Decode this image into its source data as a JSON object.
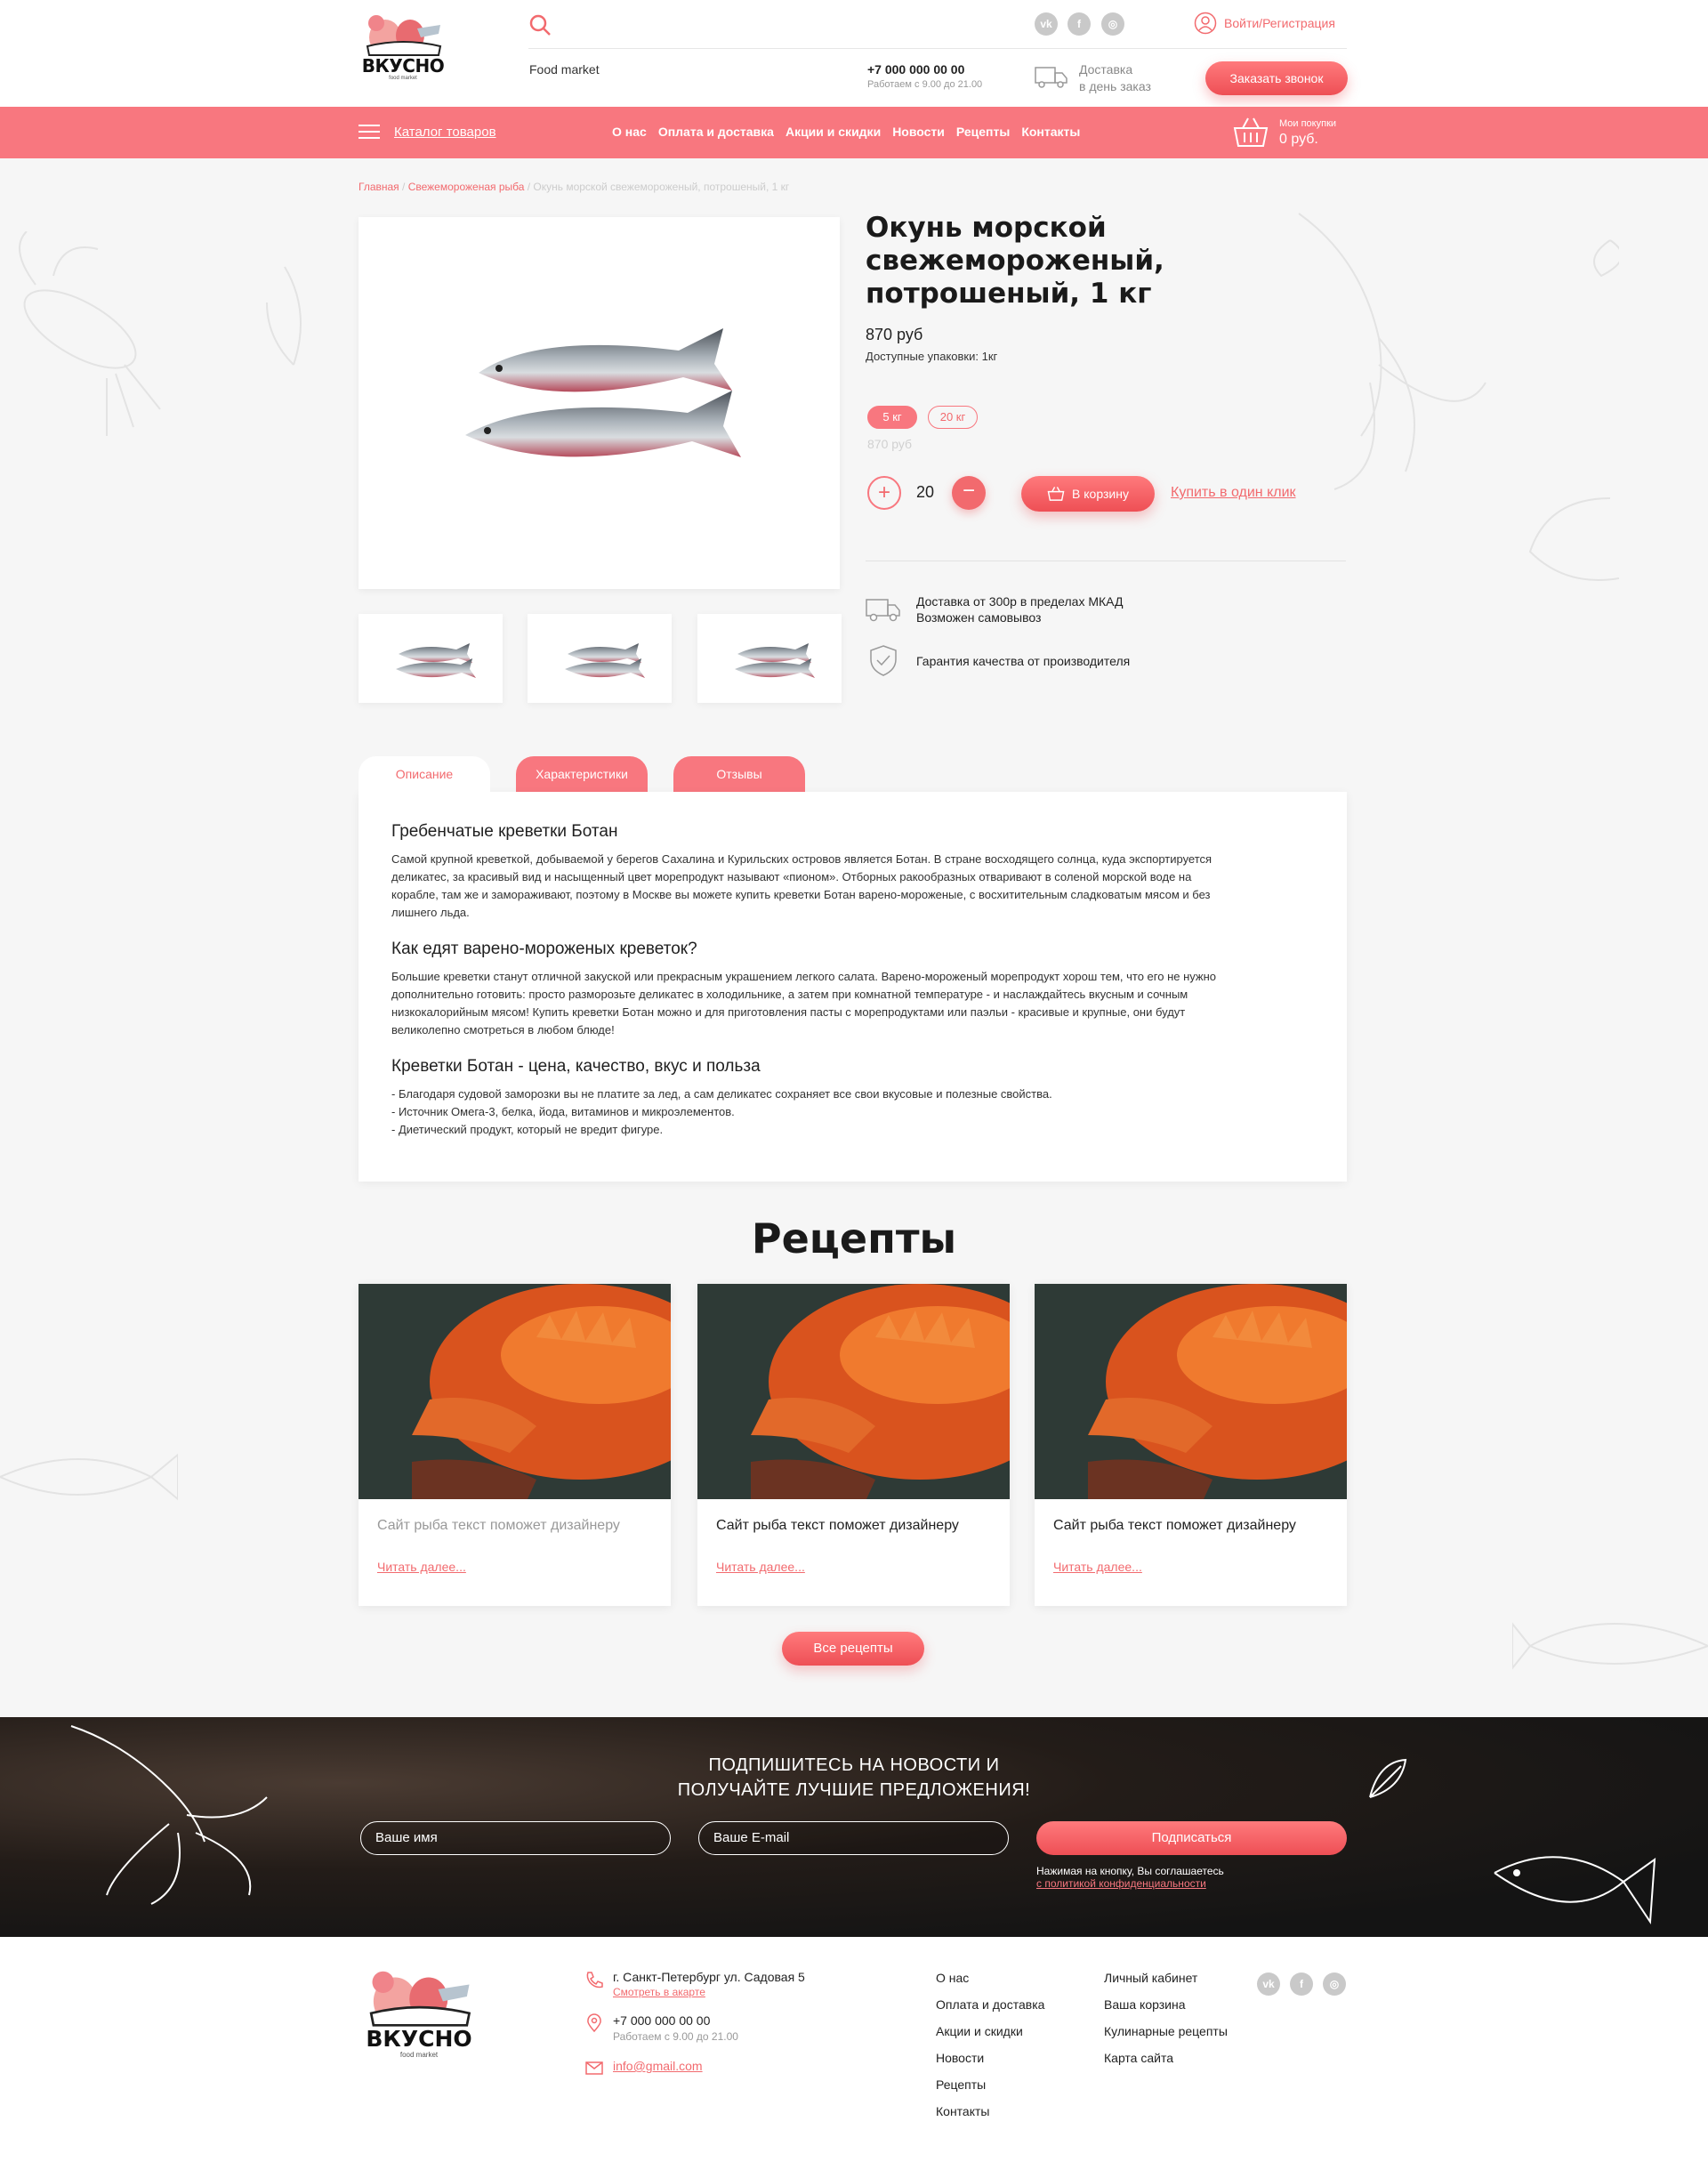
{
  "header": {
    "brand": "ВКУСНО",
    "brand_sub": "food market",
    "tagline": "Food market",
    "phone": "+7 000 000 00 00",
    "hours": "Работаем с 9.00 до 21.00",
    "delivery_line1": "Доставка",
    "delivery_line2": "в день заказ",
    "login": "Войти/Регистрация",
    "callback": "Заказать звонок",
    "social": [
      "vk-icon",
      "facebook-icon",
      "instagram-icon"
    ]
  },
  "nav": {
    "catalog": "Каталог товаров",
    "items": [
      "О нас",
      "Оплата и доставка",
      "Акции и скидки",
      "Новости",
      "Рецепты",
      "Контакты"
    ],
    "cart_label": "Мои покупки",
    "cart_value": "0 руб."
  },
  "breadcrumb": {
    "home": "Главная",
    "category": "Свежемороженая рыба",
    "current": "Окунь морской свежемороженый, потрошеный, 1 кг"
  },
  "product": {
    "title": "Окунь морской свежемороженый, потрошеный, 1 кг",
    "price": "870 руб",
    "available": "Доступные упаковки: 1кг",
    "packs": [
      "5 кг",
      "20 кг"
    ],
    "old_price": "870 руб",
    "qty_minus": "+",
    "qty_plus": "−",
    "quantity": "20",
    "to_cart": "В корзину",
    "one_click": "Купить в один клик",
    "feature_delivery_1": "Доставка от 300р в пределах МКАД",
    "feature_delivery_2": "Возможен самовывоз",
    "feature_quality": "Гарантия качества от производителя"
  },
  "tabs": [
    "Описание",
    "Характеристики",
    "Отзывы"
  ],
  "description": {
    "h1": "Гребенчатые креветки Ботан",
    "p1": "Самой крупной креветкой, добываемой у берегов Сахалина и Курильских островов является Ботан. В стране восходящего солнца, куда экспортируется деликатес, за красивый вид и насыщенный цвет морепродукт называют «пионом». Отборных ракообразных отваривают в соленой морской воде на корабле, там же и замораживают, поэтому в Москве вы можете купить креветки Ботан варено-мороженые, с восхитительным сладковатым мясом и без лишнего льда.",
    "h2": "Как едят варено-мороженых креветок?",
    "p2": "Большие креветки станут отличной закуской или прекрасным украшением легкого салата. Варено-мороженый морепродукт хорош тем, что его не нужно дополнительно готовить: просто разморозьте деликатес в холодильнике, а затем при комнатной температуре - и наслаждайтесь вкусным и сочным низкокалорийным мясом! Купить креветки Ботан можно и для приготовления пасты с морепродуктами или паэльи - красивые и крупные, они будут великолепно смотреться в любом блюде!",
    "h3": "Креветки Ботан - цена, качество, вкус и польза",
    "li1": "- Благодаря судовой заморозки вы не платите за лед, а сам деликатес сохраняет все свои вкусовые и полезные свойства.",
    "li2": "- Источник Омега-3, белка, йода, витаминов и микроэлементов.",
    "li3": "- Диетический продукт, который не вредит фигуре."
  },
  "recipes": {
    "title": "Рецепты",
    "cards": [
      {
        "text": "Сайт рыба текст поможет дизайнеру",
        "more": "Читать далее..."
      },
      {
        "text": "Сайт рыба текст поможет дизайнеру",
        "more": "Читать далее..."
      },
      {
        "text": "Сайт рыба текст поможет дизайнеру",
        "more": "Читать далее..."
      }
    ],
    "all": "Все рецепты"
  },
  "subscribe": {
    "line1": "ПОДПИШИТЕСЬ НА НОВОСТИ И",
    "line2": "ПОЛУЧАЙТЕ ЛУЧШИЕ ПРЕДЛОЖЕНИЯ!",
    "name_placeholder": "Ваше имя",
    "email_placeholder": "Ваше E-mail",
    "button": "Подписаться",
    "note": "Нажимая на кнопку, Вы соглашаетесь",
    "policy": "с политикой конфиденциальности"
  },
  "footer": {
    "address": "г. Санкт-Петербург ул. Садовая 5",
    "map_link": "Смотреть в акарте",
    "phone": "+7 000 000 00 00",
    "hours": "Работаем с 9.00 до 21.00",
    "email": "info@gmail.com",
    "col1": [
      "О нас",
      "Оплата и доставка",
      "Акции и скидки",
      "Новости",
      "Рецепты",
      "Контакты"
    ],
    "col2": [
      "Личный кабинет",
      "Ваша корзина",
      "Кулинарные рецепты",
      "Карта сайта"
    ]
  },
  "colors": {
    "accent": "#f8777f",
    "accent_dark": "#ee4f55"
  }
}
